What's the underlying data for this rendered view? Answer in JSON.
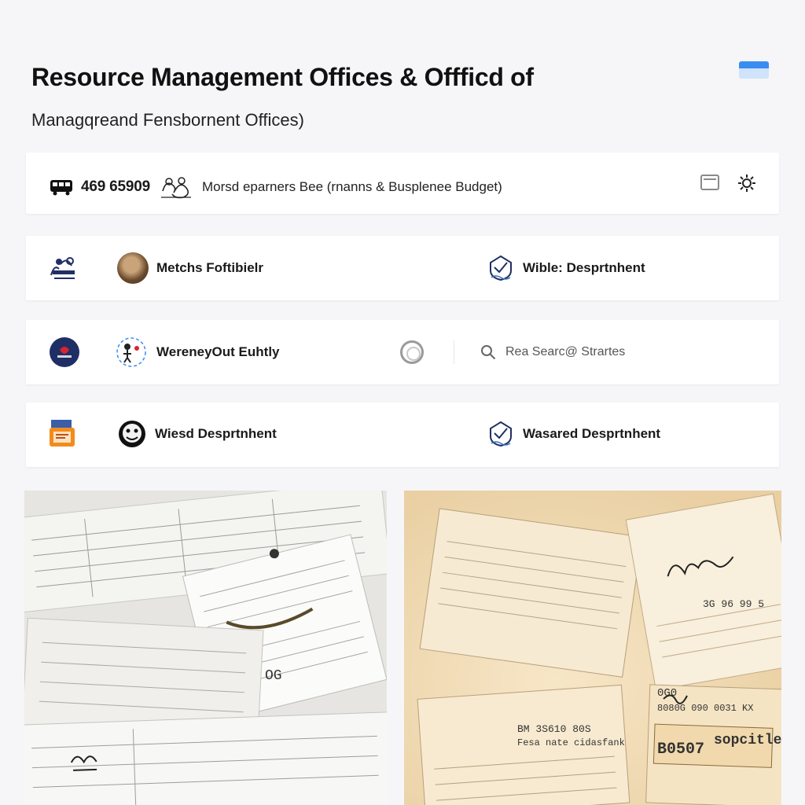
{
  "header": {
    "title": "Resource Management Offices & Offficd of",
    "subtitle": "Managqreand Fensbornent Offices)"
  },
  "info_bar": {
    "phone": "469 65909",
    "description": "Morsd eparners Bee (rnanns & Busplenee Budget)"
  },
  "rows": [
    {
      "left_label": "Metchs Foftibielr",
      "right_label": "Wible: Desprtnhent"
    },
    {
      "left_label": "WereneyOut Euhtly",
      "search_placeholder": "Rea Searc@ Strartes"
    },
    {
      "left_label": "Wiesd Desprtnhent",
      "right_label": "Wasared Desprtnhent"
    }
  ],
  "photos": {
    "left": {
      "stamp": "OG"
    },
    "right": {
      "ref_number": "3G 96 99 5",
      "code_1": "0G0",
      "code_2": "8080G 090 0031 KX",
      "ref_2": "BM 3S610 80S",
      "caption": "Fesa nate cidasfank",
      "stamp_code": "B0507",
      "stamp_label": "sopcitle"
    }
  },
  "colors": {
    "accent_blue": "#3a8df0",
    "navy": "#1f2f66",
    "orange": "#f28c1c"
  }
}
